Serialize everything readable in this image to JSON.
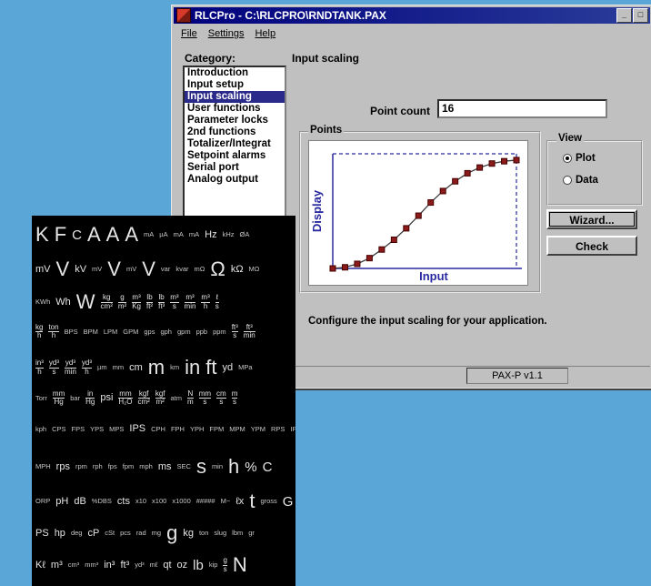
{
  "window": {
    "title": "RLCPro - C:\\RLCPRO\\RNDTANK.PAX",
    "min_glyph": "_",
    "max_glyph": "□"
  },
  "menu": [
    "File",
    "Settings",
    "Help"
  ],
  "category": {
    "label": "Category:",
    "items": [
      "Introduction",
      "Input setup",
      "Input scaling",
      "User functions",
      "Parameter locks",
      "2nd functions",
      "Totalizer/Integrat",
      "Setpoint alarms",
      "Serial port",
      "Analog output"
    ],
    "selected_index": 2
  },
  "panel": {
    "title": "Input scaling",
    "point_count_label": "Point count",
    "point_count_value": "16",
    "points_label": "Points",
    "view_label": "View",
    "view_options": [
      "Plot",
      "Data"
    ],
    "view_selected": "Plot",
    "wizard_button": "Wizard...",
    "check_button": "Check",
    "status_text": "Configure the input scaling for your application."
  },
  "chart_data": {
    "type": "line",
    "xlabel": "Input",
    "ylabel": "Display",
    "x": [
      0,
      1,
      2,
      3,
      4,
      5,
      6,
      7,
      8,
      9,
      10,
      11,
      12,
      13,
      14,
      15
    ],
    "values": [
      0,
      0.2,
      0.8,
      1.8,
      3.3,
      5.0,
      7.0,
      9.2,
      11.5,
      13.5,
      15.2,
      16.6,
      17.6,
      18.3,
      18.7,
      18.9
    ],
    "xlim": [
      0,
      15
    ],
    "ylim": [
      0,
      20
    ],
    "marker_color": "#8b1a1a",
    "line_color": "#3c3c3c",
    "label_color": "#2a2aa0",
    "bound_line_style": "dashed"
  },
  "statusbar": {
    "version": "PAX-P v1.1"
  },
  "symbols_sheet": {
    "rows": [
      [
        [
          "K",
          "xl"
        ],
        [
          "F",
          "xl"
        ],
        [
          "C",
          "l"
        ],
        [
          "A",
          "xl"
        ],
        [
          "A",
          "xl"
        ],
        [
          "A",
          "xl"
        ],
        [
          "mA",
          "s"
        ],
        [
          "µA",
          "s"
        ],
        [
          "mA",
          "s"
        ],
        [
          "mA",
          "s"
        ],
        [
          "Hz",
          "m"
        ],
        [
          "kHz",
          "s"
        ],
        [
          "ØA",
          "s"
        ]
      ],
      [
        [
          "mV",
          "m"
        ],
        [
          "V",
          "xl"
        ],
        [
          "kV",
          "m"
        ],
        [
          "mV",
          "s"
        ],
        [
          "V",
          "xl"
        ],
        [
          "mV",
          "s"
        ],
        [
          "V",
          "xl"
        ],
        [
          "var",
          "s"
        ],
        [
          "kvar",
          "s"
        ],
        [
          "mΩ",
          "s"
        ],
        [
          "Ω",
          "xl"
        ],
        [
          "kΩ",
          "m"
        ],
        [
          "MΩ",
          "s"
        ]
      ],
      [
        [
          "KWh",
          "s"
        ],
        [
          "Wh",
          "m"
        ],
        [
          "W",
          "xl"
        ],
        [
          "kg/cm²",
          "frac"
        ],
        [
          "g/m²",
          "frac"
        ],
        [
          "m³/Kg",
          "frac"
        ],
        [
          "lb/ft²",
          "frac"
        ],
        [
          "lb/ft³",
          "frac"
        ],
        [
          "m³/s",
          "frac"
        ],
        [
          "m³/min",
          "frac"
        ],
        [
          "m³/h",
          "frac"
        ],
        [
          "ℓ/s",
          "frac"
        ]
      ],
      [
        [
          "kg/h",
          "frac"
        ],
        [
          "ton/h",
          "frac"
        ],
        [
          "BPS",
          "s"
        ],
        [
          "BPM",
          "s"
        ],
        [
          "LPM",
          "s"
        ],
        [
          "GPM",
          "s"
        ],
        [
          "gps",
          "s"
        ],
        [
          "gph",
          "s"
        ],
        [
          "gpm",
          "s"
        ],
        [
          "ppb",
          "s"
        ],
        [
          "ppm",
          "s"
        ],
        [
          "ft³/s",
          "frac"
        ],
        [
          "ft³/min",
          "frac"
        ]
      ],
      [
        [
          "in³/h",
          "frac"
        ],
        [
          "yd³/s",
          "frac"
        ],
        [
          "yd³/min",
          "frac"
        ],
        [
          "yd³/h",
          "frac"
        ],
        [
          "µm",
          "s"
        ],
        [
          "mm",
          "s"
        ],
        [
          "cm",
          "m"
        ],
        [
          "m",
          "xl"
        ],
        [
          "km",
          "s"
        ],
        [
          "in",
          "xl"
        ],
        [
          "ft",
          "xl"
        ],
        [
          "yd",
          "m"
        ],
        [
          "MPa",
          "s"
        ]
      ],
      [
        [
          "Torr",
          "s"
        ],
        [
          "mm/Hg",
          "frac"
        ],
        [
          "bar",
          "s"
        ],
        [
          "in/Hg",
          "frac"
        ],
        [
          "psi",
          "m"
        ],
        [
          "mm/H₂O",
          "frac"
        ],
        [
          "kgf/cm²",
          "frac"
        ],
        [
          "kgf/m²",
          "frac"
        ],
        [
          "atm",
          "s"
        ],
        [
          "N/m",
          "frac"
        ],
        [
          "mm/s",
          "frac"
        ],
        [
          "cm/s",
          "frac"
        ],
        [
          "m/s",
          "frac"
        ]
      ],
      [
        [
          "kph",
          "s"
        ],
        [
          "CPS",
          "s"
        ],
        [
          "FPS",
          "s"
        ],
        [
          "YPS",
          "s"
        ],
        [
          "MPS",
          "s"
        ],
        [
          "IPS",
          "m"
        ],
        [
          "CPH",
          "s"
        ],
        [
          "FPH",
          "s"
        ],
        [
          "YPH",
          "s"
        ],
        [
          "FPM",
          "s"
        ],
        [
          "MPM",
          "s"
        ],
        [
          "YPM",
          "s"
        ],
        [
          "RPS",
          "s"
        ],
        [
          "IP",
          "s"
        ]
      ],
      [
        [
          "MPH",
          "s"
        ],
        [
          "rps",
          "m"
        ],
        [
          "rpm",
          "s"
        ],
        [
          "rph",
          "s"
        ],
        [
          "fps",
          "s"
        ],
        [
          "fpm",
          "s"
        ],
        [
          "mph",
          "s"
        ],
        [
          "ms",
          "m"
        ],
        [
          "SEC",
          "s"
        ],
        [
          "s",
          "xl"
        ],
        [
          "min",
          "s"
        ],
        [
          "h",
          "xl"
        ],
        [
          "%",
          "l"
        ],
        [
          "C",
          "l"
        ]
      ],
      [
        [
          "ORP",
          "s"
        ],
        [
          "pH",
          "m"
        ],
        [
          "dB",
          "m"
        ],
        [
          "%DBS",
          "s"
        ],
        [
          "cts",
          "m"
        ],
        [
          "x10",
          "s"
        ],
        [
          "x100",
          "s"
        ],
        [
          "x1000",
          "s"
        ],
        [
          "#####",
          "s"
        ],
        [
          "M~",
          "s"
        ],
        [
          "ℓx",
          "m"
        ],
        [
          "t",
          "xl"
        ],
        [
          "gross",
          "s"
        ],
        [
          "G",
          "l"
        ]
      ],
      [
        [
          "PS",
          "m"
        ],
        [
          "hp",
          "m"
        ],
        [
          "deg",
          "s"
        ],
        [
          "cP",
          "m"
        ],
        [
          "cSt",
          "s"
        ],
        [
          "pcs",
          "s"
        ],
        [
          "rad",
          "s"
        ],
        [
          "mg",
          "s"
        ],
        [
          "g",
          "xl"
        ],
        [
          "kg",
          "m"
        ],
        [
          "ton",
          "s"
        ],
        [
          "slug",
          "s"
        ],
        [
          "lbm",
          "s"
        ],
        [
          "gr",
          "s"
        ]
      ],
      [
        [
          "Kℓ",
          "m"
        ],
        [
          "m³",
          "m"
        ],
        [
          "cm³",
          "s"
        ],
        [
          "mm³",
          "s"
        ],
        [
          "in³",
          "m"
        ],
        [
          "ft³",
          "m"
        ],
        [
          "yd³",
          "s"
        ],
        [
          "mℓ",
          "s"
        ],
        [
          "qt",
          "m"
        ],
        [
          "oz",
          "m"
        ],
        [
          "lb",
          "l"
        ],
        [
          "kip",
          "s"
        ],
        [
          "g/s",
          "frac"
        ],
        [
          "N",
          "xl"
        ]
      ]
    ]
  }
}
